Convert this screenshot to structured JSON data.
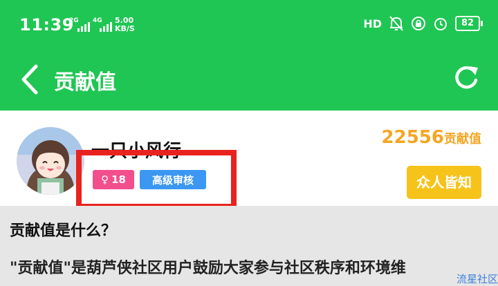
{
  "status_bar": {
    "time": "11:39",
    "sim1": "2G",
    "sim2": "4G",
    "speed_value": "5.00",
    "speed_unit": "KB/S",
    "hd_label": "HD",
    "battery": "82",
    "icons": [
      "signal-icon",
      "hd-voice-icon",
      "bell-off-icon",
      "lock-rotation-icon",
      "alarm-icon",
      "battery-icon"
    ]
  },
  "navbar": {
    "title": "贡献值",
    "back_icon": "chevron-left-icon",
    "refresh_icon": "refresh-icon"
  },
  "profile": {
    "username": "一只小风行",
    "gender_icon": "female-icon",
    "age": "18",
    "level_badge": "高级审核",
    "score_value": "22556",
    "score_unit": "贡献值",
    "notify_label": "众人皆知"
  },
  "content": {
    "question": "贡献值是什么？",
    "description": "\"贡献值\"是葫芦侠社区用户鼓励大家参与社区秩序和环境维"
  },
  "watermark": "流星社区",
  "colors": {
    "header_green": "#1fc653",
    "score_orange": "#f5a623",
    "notify_yellow": "#f6c31a",
    "gender_pink": "#f24f8c",
    "level_blue": "#3b97f2",
    "highlight_red": "#e8221e"
  }
}
